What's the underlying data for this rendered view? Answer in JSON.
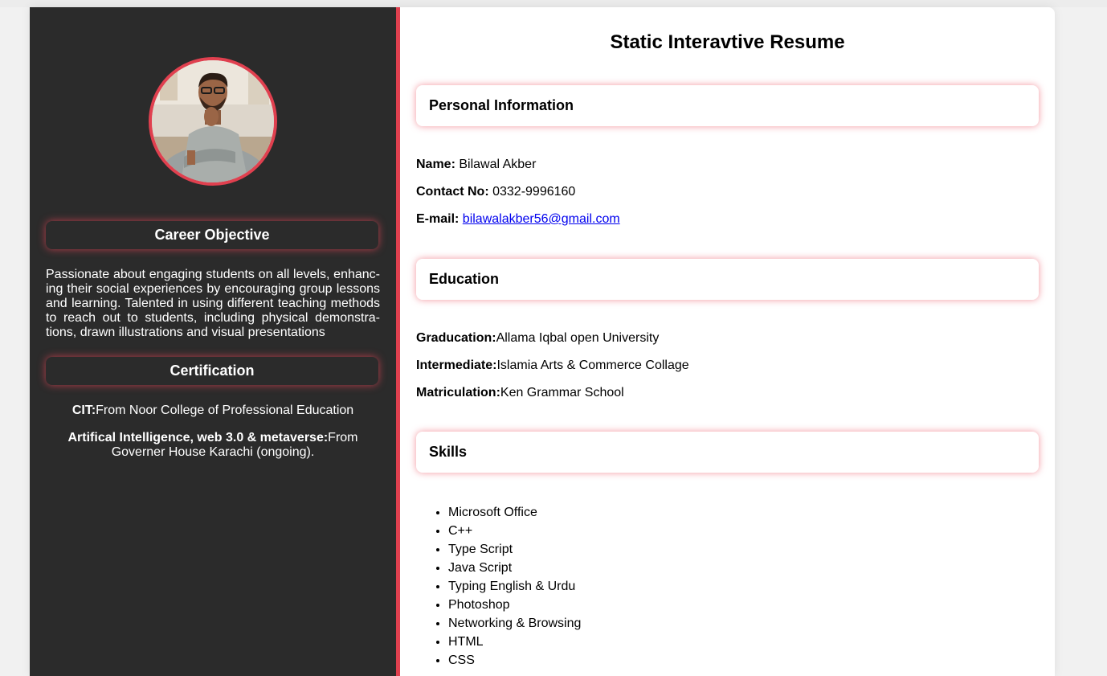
{
  "main": {
    "title": "Static Interavtive Resume",
    "personal": {
      "heading": "Personal Information",
      "name_label": "Name:",
      "name_value": "Bilawal Akber",
      "contact_label": "Contact No:",
      "contact_value": "0332-9996160",
      "email_label": "E-mail:",
      "email_value": "bilawalakber56@gmail.com"
    },
    "education": {
      "heading": "Education",
      "graduation_label": "Graducation:",
      "graduation_value": "Allama Iqbal open University",
      "intermediate_label": "Intermediate:",
      "intermediate_value": "Islamia Arts & Commerce Collage",
      "matric_label": "Matriculation:",
      "matric_value": "Ken Grammar School"
    },
    "skills": {
      "heading": "Skills",
      "items": [
        "Microsoft Office",
        "C++",
        "Type Script",
        "Java Script",
        "Typing English & Urdu",
        "Photoshop",
        "Networking & Browsing",
        "HTML",
        "CSS"
      ]
    }
  },
  "sidebar": {
    "career_heading": "Career Objective",
    "career_text": "Passionate about engaging students on all levels, enhanc­ing their social experiences by encouraging group lessons and learning. Talented in using different teaching methods to reach out to students, including physical demonstra­tions, drawn illustrations and visual presentations",
    "cert_heading": "Certification",
    "cert1_label": "CIT:",
    "cert1_value": "From Noor College of Professional Education",
    "cert2_label": "Artifical Intelligence, web 3.0 & metaverse:",
    "cert2_value": "From Governer House Karachi (ongoing)."
  },
  "colors": {
    "sidebar_bg": "#2b2b2b",
    "accent": "#e0404f"
  }
}
